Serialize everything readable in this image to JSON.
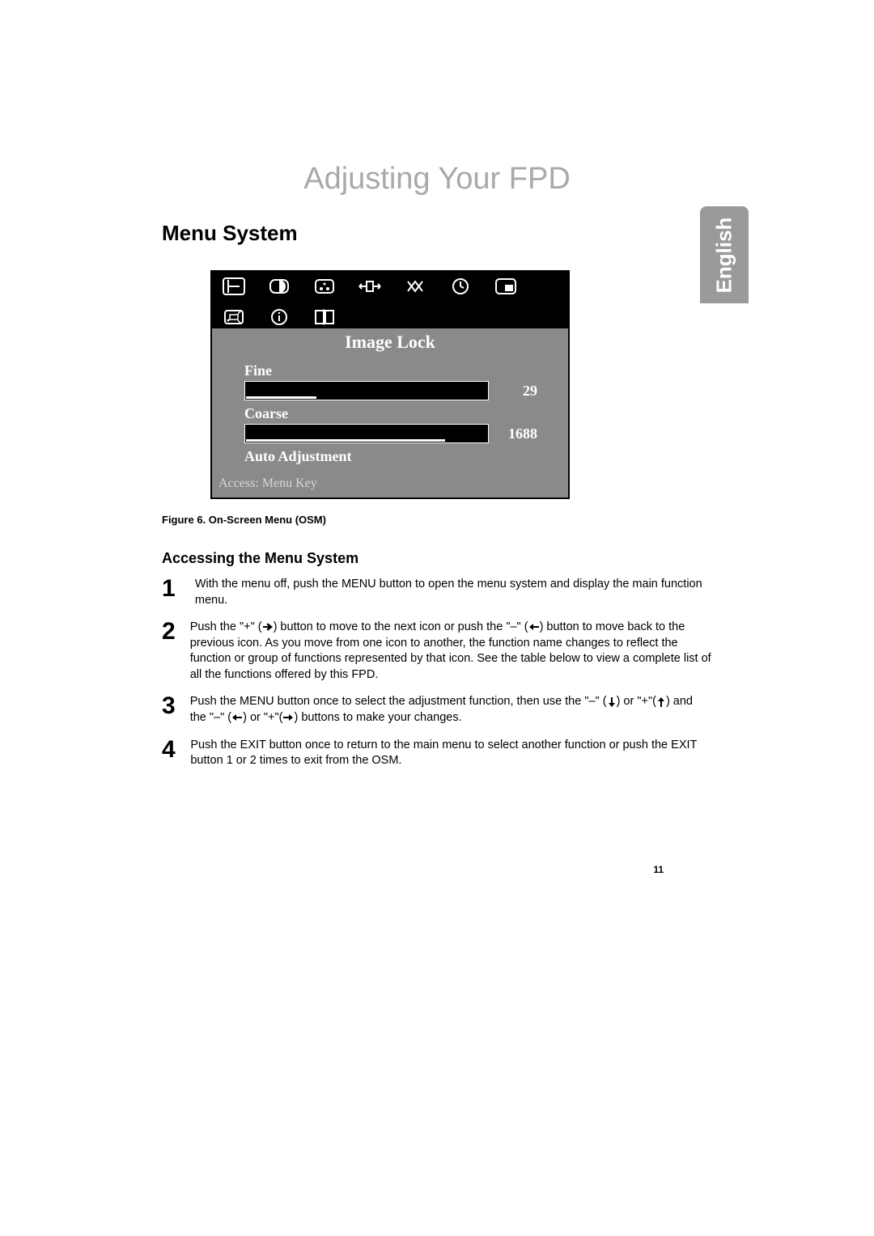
{
  "chapter_title": "Adjusting Your FPD",
  "section_title": "Menu System",
  "language_tab": "English",
  "osm": {
    "title": "Image Lock",
    "items": [
      {
        "label": "Fine",
        "value": "29",
        "fill_pct": 29
      },
      {
        "label": "Coarse",
        "value": "1688",
        "fill_pct": 82
      }
    ],
    "auto_label": "Auto Adjustment",
    "access_text": "Access: Menu Key",
    "icon_names": [
      "image-lock-icon",
      "brightness-icon",
      "color-icon",
      "position-icon",
      "scaling-icon",
      "clock-icon",
      "pip-icon",
      "geometry-icon",
      "info-icon",
      "exit-icon"
    ]
  },
  "figure_caption": "Figure 6.  On-Screen Menu (OSM)",
  "subheading": "Accessing the Menu System",
  "steps": [
    {
      "num": "1",
      "pre": "With the menu off, push the MENU button to open the menu system and display the main function menu."
    },
    {
      "num": "2",
      "pre": "Push the \"+\" (",
      "mid1": ") button to move to the next icon or push the \"–\" (",
      "mid2": ") button to move back to the previous icon. As you move from one icon to another, the function name changes to reflect the function or group of functions represented by that icon. See the table below to view a complete list of all the functions offered by this FPD."
    },
    {
      "num": "3",
      "pre": "Push the MENU button once to select the adjustment function, then use the \"–\" (",
      "mid1": ") or \"+\"(",
      "mid2": ") and the \"–\" (",
      "mid3": ") or \"+\"(",
      "post": ") buttons to make your changes."
    },
    {
      "num": "4",
      "pre": "Push the EXIT button once to return to the main menu to select another function or push the EXIT button 1 or 2 times to exit from the OSM."
    }
  ],
  "page_number": "11"
}
